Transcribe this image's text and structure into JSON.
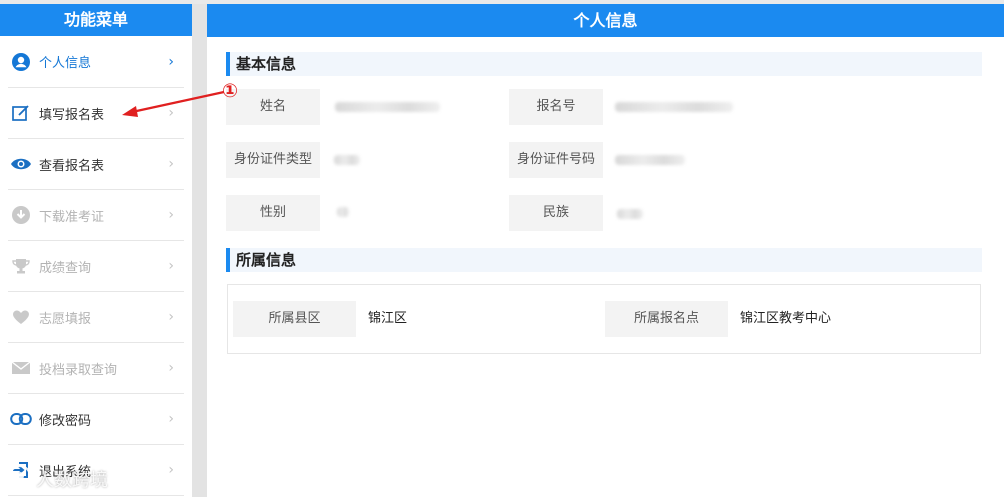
{
  "sidebar": {
    "title": "功能菜单",
    "items": [
      {
        "label": "个人信息",
        "icon": "user-circle-icon",
        "state": "active"
      },
      {
        "label": "填写报名表",
        "icon": "edit-icon",
        "state": "normal"
      },
      {
        "label": "查看报名表",
        "icon": "eye-icon",
        "state": "normal"
      },
      {
        "label": "下载准考证",
        "icon": "download-icon",
        "state": "disabled"
      },
      {
        "label": "成绩查询",
        "icon": "trophy-icon",
        "state": "disabled"
      },
      {
        "label": "志愿填报",
        "icon": "heart-icon",
        "state": "disabled"
      },
      {
        "label": "投档录取查询",
        "icon": "envelope-icon",
        "state": "disabled"
      },
      {
        "label": "修改密码",
        "icon": "link-icon",
        "state": "normal"
      },
      {
        "label": "退出系统",
        "icon": "exit-icon",
        "state": "normal"
      }
    ]
  },
  "main": {
    "title": "个人信息",
    "basic": {
      "title": "基本信息",
      "name_label": "姓名",
      "regno_label": "报名号",
      "idtype_label": "身份证件类型",
      "idno_label": "身份证件号码",
      "gender_label": "性别",
      "ethnic_label": "民族"
    },
    "affiliation": {
      "title": "所属信息",
      "county_label": "所属县区",
      "county_value": "锦江区",
      "site_label": "所属报名点",
      "site_value": "锦江区教考中心"
    }
  },
  "annotation": {
    "marker": "①"
  },
  "watermark": {
    "text": "人数跨境"
  },
  "colors": {
    "accent": "#1b8af0",
    "active_text": "#1477d6",
    "annotation": "#e02020",
    "disabled": "#b3b3b3"
  }
}
